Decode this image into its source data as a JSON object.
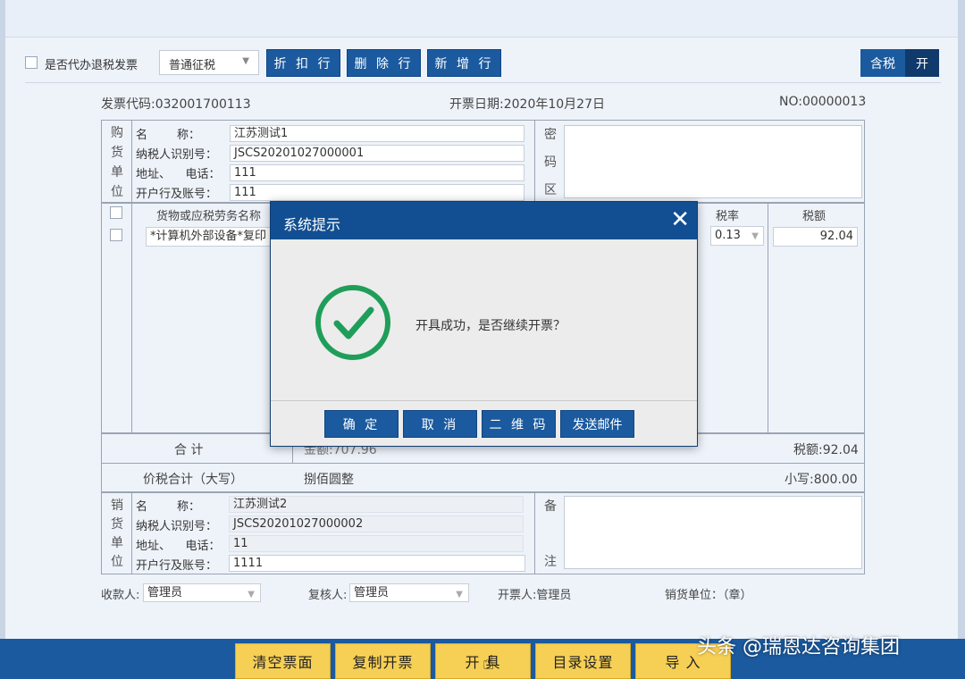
{
  "toolbar": {
    "refund_checkbox_label": "是否代办退税发票",
    "tax_type_selected": "普通征税",
    "discount_button": "折 扣 行",
    "delete_button": "删 除 行",
    "add_button": "新 增 行",
    "tax_incl_label": "含税",
    "tax_incl_state": "开"
  },
  "invoice": {
    "code": "发票代码:032001700113",
    "date": "开票日期:2020年10月27日",
    "number": "NO:00000013",
    "buyer_section": [
      "购",
      "货",
      "单",
      "位"
    ],
    "buyer": {
      "name_label": "名        称：",
      "name_value": "江苏测试1",
      "taxid_label": "纳税人识别号：",
      "taxid_value": "JSCS20201027000001",
      "addr_label": "地址、    电话：",
      "addr_value": "111",
      "bank_label": "开户行及账号：",
      "bank_value": "111"
    },
    "cipher_section": [
      "密",
      "码",
      "区"
    ],
    "goods_header": "货物或应税劳务名称",
    "goods_item": "*计算机外部设备*复印",
    "tax_rate_header": "税率",
    "tax_rate_value": "0.13",
    "tax_amount_header": "税额",
    "tax_amount_value": "92.04",
    "total_label": "合    计",
    "total_amount": "金额:707.96",
    "total_tax": "税额:92.04",
    "grand_total_label": "价税合计（大写）",
    "grand_total_words": "捌佰圆整",
    "grand_total_small": "小写:800.00",
    "seller_section": [
      "销",
      "货",
      "单",
      "位"
    ],
    "seller": {
      "name_label": "名        称：",
      "name_value": "江苏测试2",
      "taxid_label": "纳税人识别号：",
      "taxid_value": "JSCS20201027000002",
      "addr_label": "地址、    电话：",
      "addr_value": "11",
      "bank_label": "开户行及账号：",
      "bank_value": "1111"
    },
    "remark_section": [
      "备",
      "注"
    ],
    "payee_label": "收款人:",
    "payee_value": "管理员",
    "reviewer_label": "复核人:",
    "reviewer_value": "管理员",
    "issuer": "开票人:管理员",
    "seller_seal": "销货单位：（章）"
  },
  "bottom_buttons": {
    "clear": "清空票面",
    "copy": "复制开票",
    "issue": "开 具",
    "catalog": "目录设置",
    "import": "导 入"
  },
  "watermark": "头条 @瑞恩达咨询集团",
  "dialog": {
    "title": "系统提示",
    "message": "开具成功，是否继续开票？",
    "ok": "确 定",
    "cancel": "取 消",
    "qrcode": "二 维 码",
    "email": "发送邮件",
    "success_color": "#1f9e5a"
  }
}
